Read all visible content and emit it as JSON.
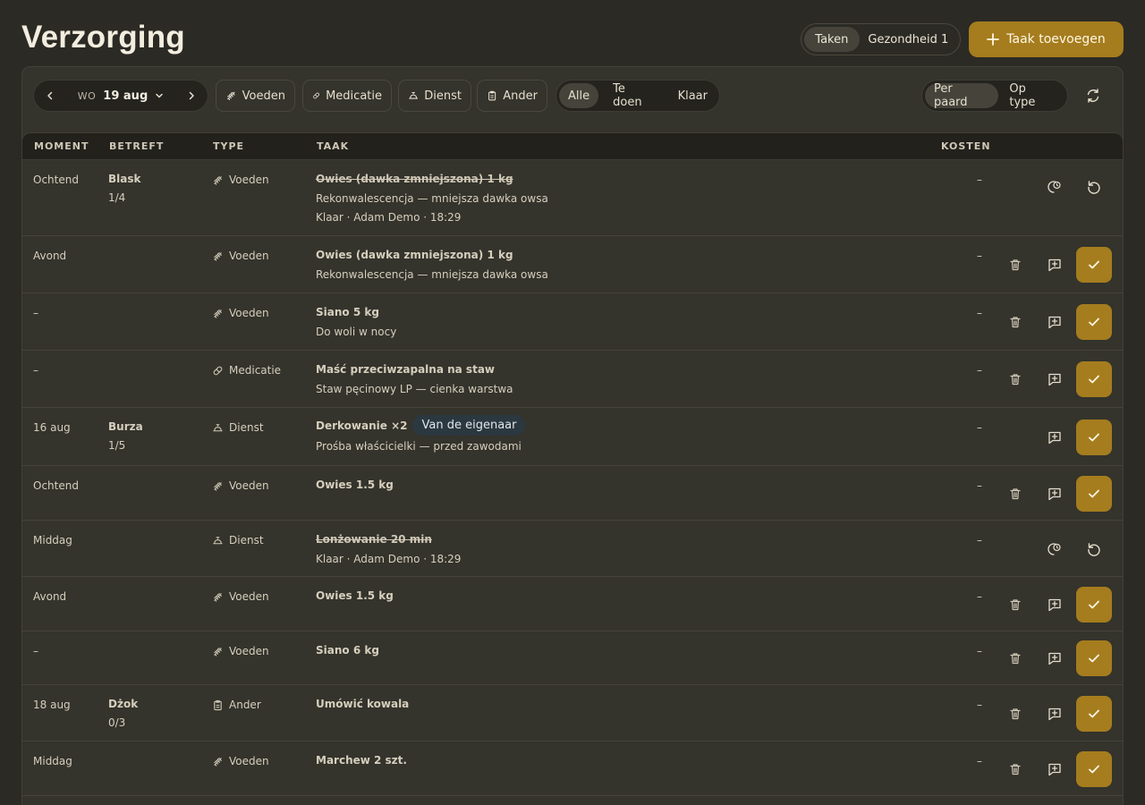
{
  "header": {
    "title": "Verzorging",
    "tabs": [
      {
        "label": "Taken",
        "active": true
      },
      {
        "label": "Gezondheid 1",
        "active": false
      }
    ],
    "add_button": "Taak toevoegen",
    "accent": "#a57d1e"
  },
  "toolbar": {
    "date_dow": "WO",
    "date": "19 aug",
    "type_filters": [
      {
        "label": "Voeden",
        "icon": "feed-icon"
      },
      {
        "label": "Medicatie",
        "icon": "pill-icon"
      },
      {
        "label": "Dienst",
        "icon": "service-bell-icon"
      },
      {
        "label": "Ander",
        "icon": "clipboard-icon"
      }
    ],
    "status_filters": [
      {
        "label": "Alle",
        "active": true
      },
      {
        "label": "Te doen",
        "active": false
      },
      {
        "label": "Klaar",
        "active": false
      }
    ],
    "views": [
      {
        "label": "Per paard",
        "active": true
      },
      {
        "label": "Op type",
        "active": false
      }
    ]
  },
  "table": {
    "headers": {
      "moment": "MOMENT",
      "horse": "BETREFT",
      "type": "TYPE",
      "task": "TAAK",
      "cost": "KOSTEN"
    },
    "rows": [
      {
        "moment": "Ochtend",
        "horse": "Blask",
        "horse_sub": "1/4",
        "type": "Voeden",
        "task": "Owies (dawka zmniejszona) 1 kg",
        "sub": "Rekonwalescencja — mniejsza dawka owsa",
        "sub2": "Klaar · Adam Demo · 18:29",
        "cost": "–",
        "done": true
      },
      {
        "moment": "Avond",
        "horse": "",
        "horse_sub": "",
        "type": "Voeden",
        "task": "Owies (dawka zmniejszona) 1 kg",
        "sub": "Rekonwalescencja — mniejsza dawka owsa",
        "cost": "–",
        "done": false
      },
      {
        "moment": "–",
        "type": "Voeden",
        "task": "Siano 5 kg",
        "sub": "Do woli w nocy",
        "cost": "–",
        "done": false
      },
      {
        "moment": "–",
        "type": "Medicatie",
        "task": "Maść przeciwzapalna na staw",
        "sub": "Staw pęcinowy LP — cienka warstwa",
        "cost": "–",
        "done": false
      },
      {
        "moment": "16 aug",
        "horse": "Burza",
        "horse_sub": "1/5",
        "type": "Dienst",
        "task": "Derkowanie ×2",
        "badge": "Van de eigenaar",
        "sub": "Prośba właścicielki — przed zawodami",
        "cost": "–",
        "done": false
      },
      {
        "moment": "Ochtend",
        "type": "Voeden",
        "task": "Owies 1.5 kg",
        "cost": "–",
        "done": false
      },
      {
        "moment": "Middag",
        "type": "Dienst",
        "task": "Lonżowanie 20 min",
        "sub": "Klaar · Adam Demo · 18:29",
        "cost": "–",
        "done": true
      },
      {
        "moment": "Avond",
        "type": "Voeden",
        "task": "Owies 1.5 kg",
        "cost": "–",
        "done": false
      },
      {
        "moment": "–",
        "type": "Voeden",
        "task": "Siano 6 kg",
        "cost": "–",
        "done": false
      },
      {
        "moment": "18 aug",
        "horse": "Dżok",
        "horse_sub": "0/3",
        "type": "Ander",
        "task": "Umówić kowala",
        "cost": "–",
        "done": false
      },
      {
        "moment": "Middag",
        "type": "Voeden",
        "task": "Marchew 2 szt.",
        "cost": "–",
        "done": false
      }
    ]
  }
}
